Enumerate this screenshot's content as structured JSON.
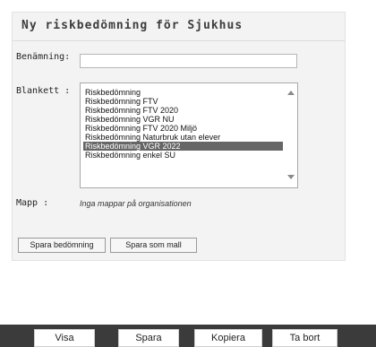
{
  "panel": {
    "title": "Ny riskbedömning  för Sjukhus"
  },
  "form": {
    "name_label": "Benämning:",
    "name_value": "",
    "form_label": "Blankett :",
    "options": [
      "Riskbedömning",
      "Riskbedömning FTV",
      "Riskbedömning FTV 2020",
      "Riskbedömning VGR NU",
      "Riskbedömning FTV 2020 Miljö",
      "Riskbedömning Naturbruk utan elever",
      "Riskbedömning VGR 2022",
      "Riskbedömning enkel SU"
    ],
    "selected": "Riskbedömning VGR 2022",
    "folder_label": "Mapp :",
    "folder_empty_text": "Inga mappar på organisationen"
  },
  "actions": {
    "save_assessment": "Spara bedömning",
    "save_template": "Spara som mall"
  },
  "bottombar": {
    "show": "Visa",
    "save": "Spara",
    "copy": "Kopiera",
    "delete": "Ta bort"
  },
  "colors": {
    "selected_bg": "#666666",
    "bottombar_bg": "#3b3b3b"
  }
}
